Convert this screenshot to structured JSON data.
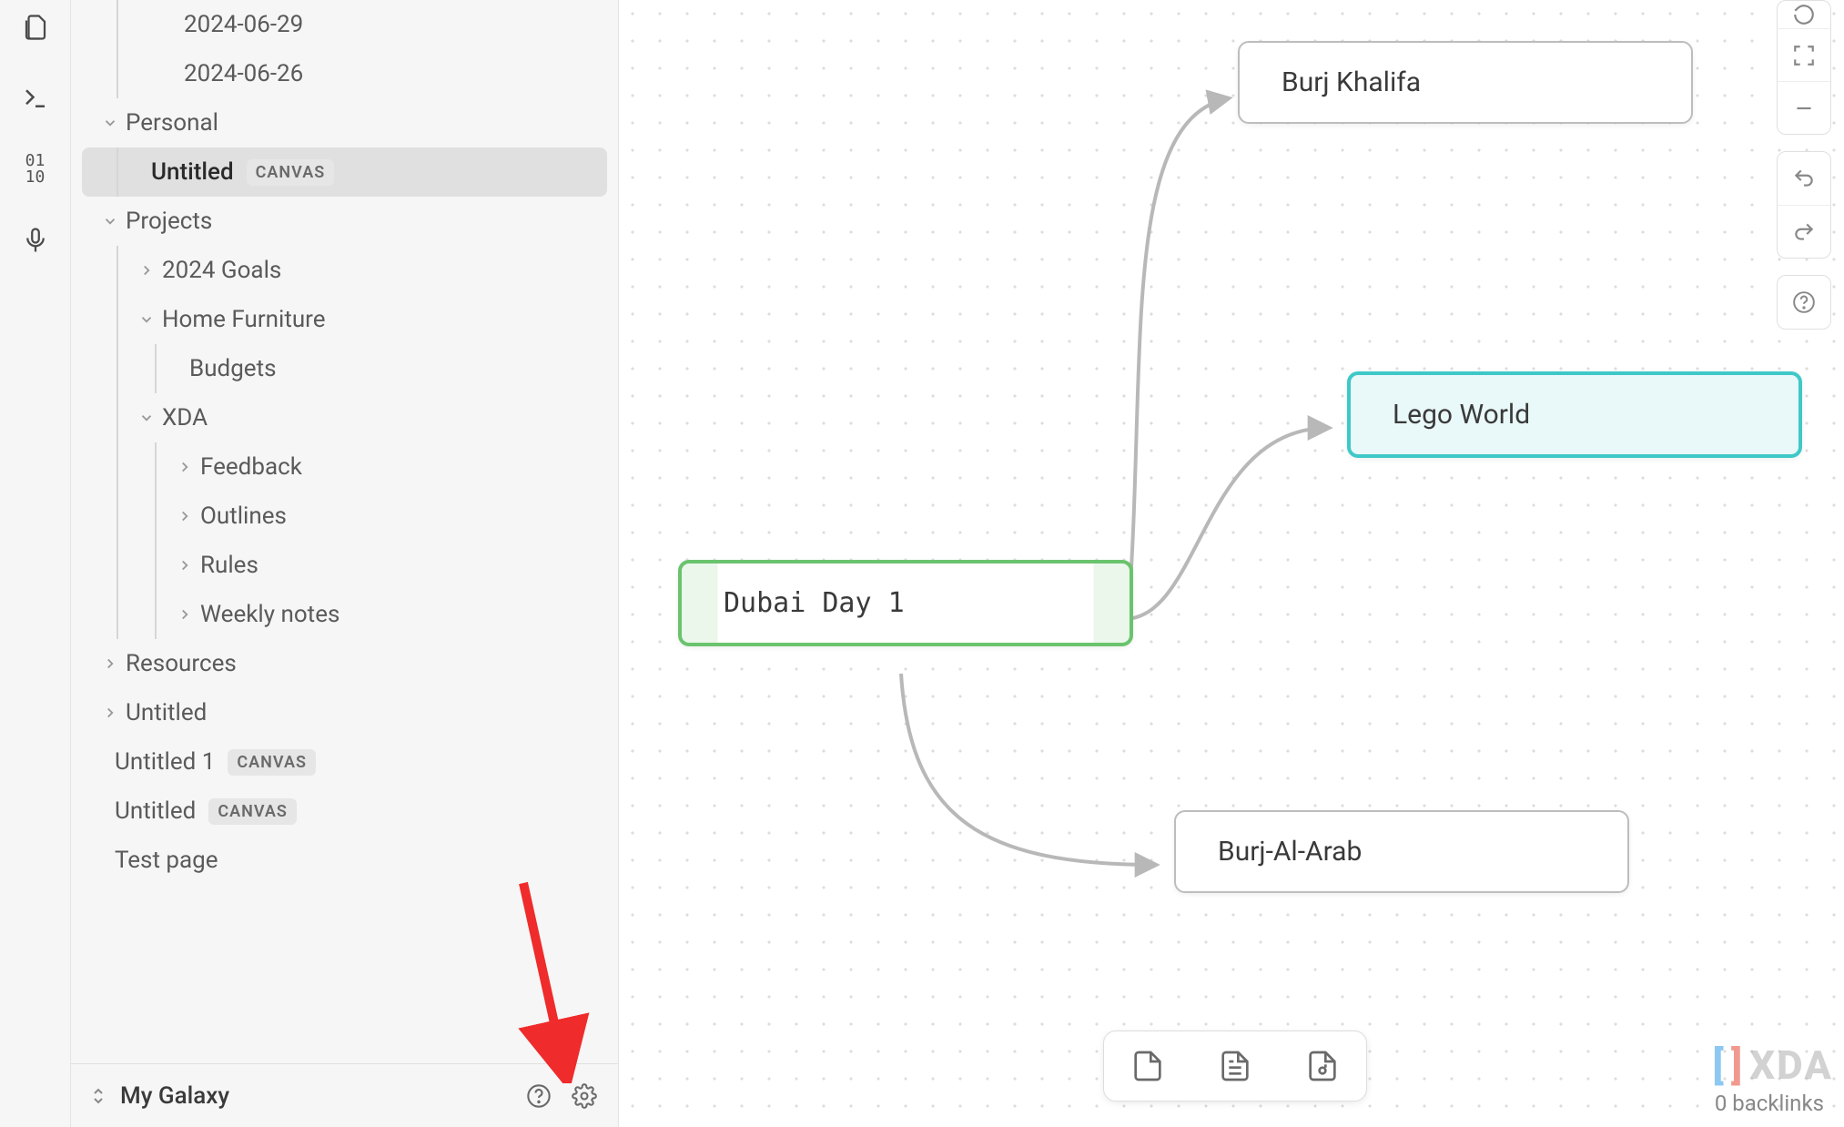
{
  "rail": {
    "icons": [
      "files-icon",
      "terminal-icon",
      "binary-icon",
      "mic-icon"
    ]
  },
  "sidebar": {
    "items": [
      {
        "label": "2024-06-29",
        "depth": 3,
        "chev": "none",
        "guide": true
      },
      {
        "label": "2024-06-26",
        "depth": 3,
        "chev": "none",
        "guide": true
      },
      {
        "label": "Personal",
        "depth": 1,
        "chev": "down"
      },
      {
        "label": "Untitled",
        "depth": 2,
        "chev": "none",
        "guide": true,
        "badge": "CANVAS",
        "selected": true
      },
      {
        "label": "Projects",
        "depth": 1,
        "chev": "down"
      },
      {
        "label": "2024 Goals",
        "depth": 2,
        "chev": "right",
        "guide": true
      },
      {
        "label": "Home Furniture",
        "depth": 2,
        "chev": "down",
        "guide": true
      },
      {
        "label": "Budgets",
        "depth": 3,
        "chev": "none",
        "guide": true,
        "doubleGuide": true
      },
      {
        "label": "XDA",
        "depth": 2,
        "chev": "down",
        "guide": true
      },
      {
        "label": "Feedback",
        "depth": 3,
        "chev": "right",
        "guide": true,
        "doubleGuide": true
      },
      {
        "label": "Outlines",
        "depth": 3,
        "chev": "right",
        "guide": true,
        "doubleGuide": true
      },
      {
        "label": "Rules",
        "depth": 3,
        "chev": "right",
        "guide": true,
        "doubleGuide": true
      },
      {
        "label": "Weekly notes",
        "depth": 3,
        "chev": "right",
        "guide": true,
        "doubleGuide": true
      },
      {
        "label": "Resources",
        "depth": 1,
        "chev": "right"
      },
      {
        "label": "Untitled",
        "depth": 1,
        "chev": "right"
      },
      {
        "label": "Untitled 1",
        "depth": 1,
        "chev": "none",
        "badge": "CANVAS"
      },
      {
        "label": "Untitled",
        "depth": 1,
        "chev": "none",
        "badge": "CANVAS"
      },
      {
        "label": "Test page",
        "depth": 1,
        "chev": "none"
      }
    ],
    "vault_name": "My Galaxy"
  },
  "canvas": {
    "nodes": {
      "root": "Dubai Day 1",
      "n1": "Burj Khalifa",
      "n2": "Lego World",
      "n3": "Burj-Al-Arab"
    },
    "toolbar": [
      "new-note-icon",
      "new-text-icon",
      "new-media-icon"
    ]
  },
  "footer": {
    "backlinks": "0 backlinks"
  },
  "watermark": "XDA"
}
